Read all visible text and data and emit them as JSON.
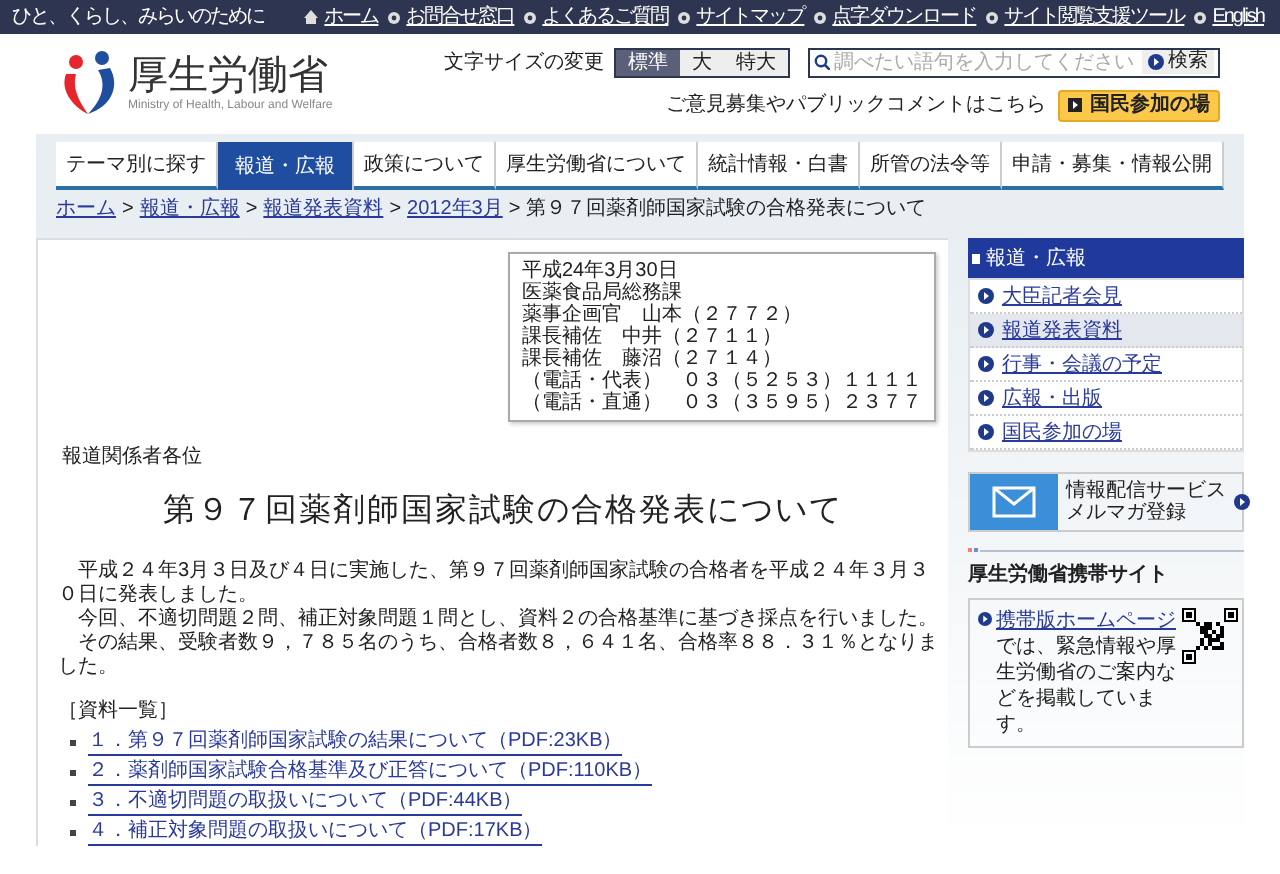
{
  "top_bar": {
    "tagline": "ひと、くらし、みらいのために",
    "links": [
      {
        "label": "ホーム",
        "kind": "home"
      },
      {
        "label": "お問合せ窓口",
        "kind": "bullet"
      },
      {
        "label": "よくあるご質問",
        "kind": "bullet"
      },
      {
        "label": "サイトマップ",
        "kind": "bullet"
      },
      {
        "label": "点字ダウンロード",
        "kind": "bullet"
      },
      {
        "label": "サイト閲覧支援ツール",
        "kind": "bullet"
      },
      {
        "label": "English",
        "kind": "bullet"
      }
    ]
  },
  "header": {
    "logo_name": "厚生労働省",
    "logo_subtitle": "Ministry of Health, Labour and Welfare",
    "font_size": {
      "label": "文字サイズの変更",
      "options": [
        {
          "label": "標準",
          "selected": true
        },
        {
          "label": "大",
          "selected": false
        },
        {
          "label": "特大",
          "selected": false
        }
      ]
    },
    "search": {
      "placeholder": "調べたい語句を入力してください",
      "button": "検索"
    },
    "comment_text": "ご意見募集やパブリックコメントはこちら",
    "participation_button": "国民参加の場"
  },
  "nav_tabs": [
    {
      "label": "テーマ別に探す",
      "selected": false
    },
    {
      "label": "報道・広報",
      "selected": true
    },
    {
      "label": "政策について",
      "selected": false
    },
    {
      "label": "厚生労働省について",
      "selected": false
    },
    {
      "label": "統計情報・白書",
      "selected": false
    },
    {
      "label": "所管の法令等",
      "selected": false
    },
    {
      "label": "申請・募集・情報公開",
      "selected": false
    }
  ],
  "breadcrumb": [
    {
      "label": "ホーム",
      "kind": "link"
    },
    {
      "label": ">",
      "kind": "separator"
    },
    {
      "label": "報道・広報",
      "kind": "link"
    },
    {
      "label": ">",
      "kind": "separator"
    },
    {
      "label": "報道発表資料",
      "kind": "link"
    },
    {
      "label": ">",
      "kind": "separator"
    },
    {
      "label": "2012年3月",
      "kind": "link"
    },
    {
      "label": ">",
      "kind": "separator"
    },
    {
      "label": "第９７回薬剤師国家試験の合格発表について",
      "kind": "current"
    }
  ],
  "main": {
    "contact_lines": [
      "平成24年3月30日",
      "医薬食品局総務課",
      "薬事企画官　山本（２７７２）",
      "課長補佐　中井（２７１１）",
      "課長補佐　藤沼（２７１４）",
      "（電話・代表）　０３（５２５３）１１１１",
      "（電話・直通）　０３（３５９５）２３７７"
    ],
    "addressee": "報道関係者各位",
    "title": "第９７回薬剤師国家試験の合格発表について",
    "paragraphs": [
      "平成２４年3月３日及び４日に実施した、第９７回薬剤師国家試験の合格者を平成２４年３月３０日に発表しました。",
      "今回、不適切問題２問、補正対象問題１問とし、資料２の合格基準に基づき採点を行いました。",
      "その結果、受験者数９，７８５名のうち、合格者数８，６４１名、合格率８８．３１％となりました。"
    ],
    "materials_heading": "［資料一覧］",
    "materials": [
      "１．第９７回薬剤師国家試験の結果について（PDF:23KB）",
      "２．薬剤師国家試験合格基準及び正答について（PDF:110KB）",
      "３．不適切問題の取扱いについて（PDF:44KB）",
      "４．補正対象問題の取扱いについて（PDF:17KB）"
    ]
  },
  "sidebar": {
    "section_title": "報道・広報",
    "items": [
      {
        "label": "大臣記者会見",
        "selected": false
      },
      {
        "label": "報道発表資料",
        "selected": true
      },
      {
        "label": "行事・会議の予定",
        "selected": false
      },
      {
        "label": "広報・出版",
        "selected": false
      },
      {
        "label": "国民参加の場",
        "selected": false
      }
    ],
    "mail_banner": [
      "情報配信サービス",
      "メルマガ登録"
    ],
    "mobile": {
      "heading": "厚生労働省携帯サイト",
      "link": "携帯版ホームページ",
      "text": "では、緊急情報や厚生労働省のご案内などを掲載しています。"
    }
  }
}
